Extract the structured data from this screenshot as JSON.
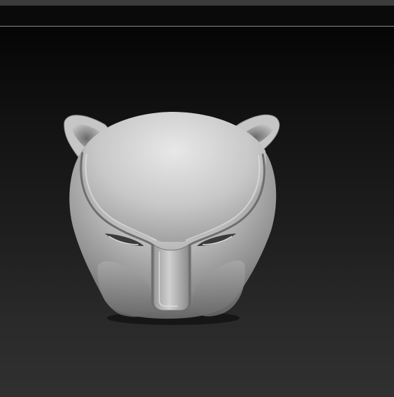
{
  "window": {
    "topbar_color": "#3c3c3c",
    "tray_color": "#0a0a0a",
    "divider_color": "#8c8c8c"
  },
  "viewport": {
    "background_top": "#050505",
    "background_bottom": "#303030",
    "model": {
      "name": "panther-head-sculpt",
      "material_color": "#b4b4b4",
      "highlight_color": "#e6e6e6",
      "shadow_color": "#4a4a4a"
    }
  }
}
